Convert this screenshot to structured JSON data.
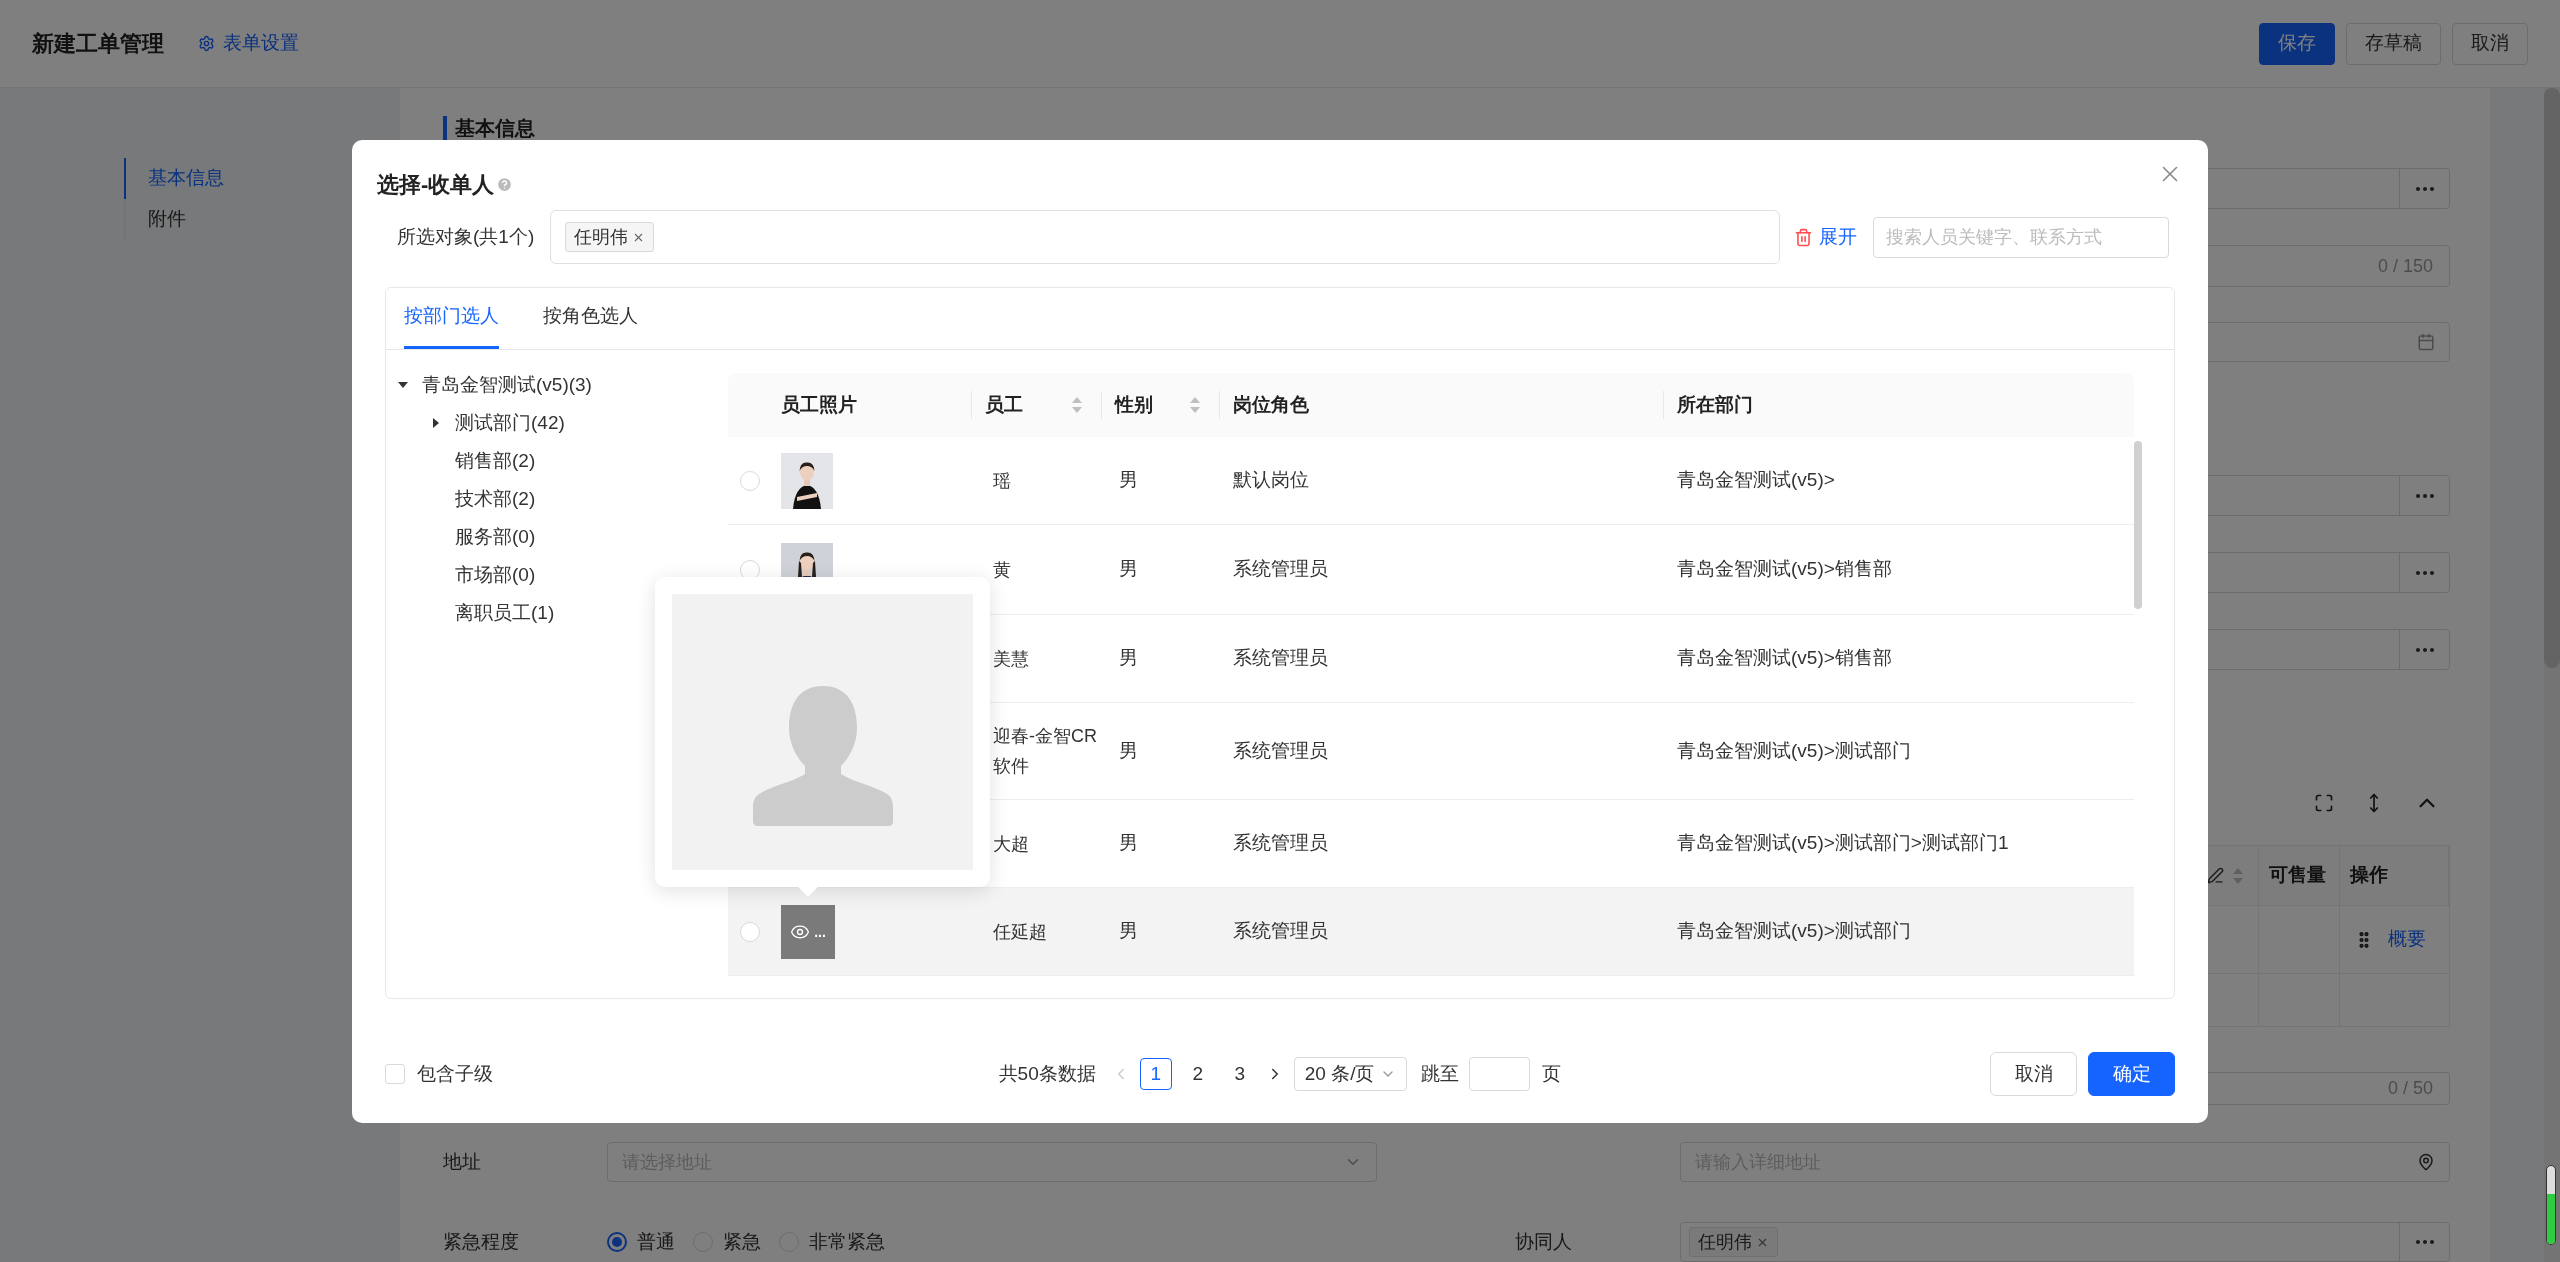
{
  "page": {
    "title": "新建工单管理",
    "settings_link": "表单设置",
    "buttons": [
      {
        "label": "保存",
        "kind": "primary"
      },
      {
        "label": "存草稿",
        "kind": "default"
      },
      {
        "label": "取消",
        "kind": "default"
      }
    ]
  },
  "nav": [
    {
      "label": "基本信息",
      "selected": true
    },
    {
      "label": "附件",
      "selected": false
    }
  ],
  "section_title": "基本信息",
  "form_top": [
    {
      "kind": "picker"
    },
    {
      "kind": "counter",
      "counter": "0 / 150"
    },
    {
      "kind": "date"
    },
    {
      "kind": "picker"
    },
    {
      "kind": "picker"
    },
    {
      "kind": "picker"
    }
  ],
  "detail_table": {
    "columns": [
      {
        "kind": "icons"
      },
      {
        "kind": "text",
        "label": "可售量"
      },
      {
        "kind": "text",
        "label": "操作"
      }
    ],
    "rows": [
      {
        "kind": "action",
        "action": "概要"
      },
      {
        "kind": "blank"
      }
    ]
  },
  "remark_counter": "0 / 50",
  "address": {
    "label": "地址",
    "region_placeholder": "请选择地址",
    "detail_placeholder": "请输入详细地址"
  },
  "urgency": {
    "label": "紧急程度",
    "options": [
      {
        "label": "普通",
        "selected": true
      },
      {
        "label": "紧急",
        "selected": false
      },
      {
        "label": "非常紧急",
        "selected": false
      }
    ]
  },
  "collaborator": {
    "label": "协同人",
    "tags": [
      "任明伟"
    ]
  },
  "modal": {
    "title": "选择-收单人",
    "selected_label": "所选对象(共1个)",
    "selected_tags": [
      "任明伟"
    ],
    "expand": "展开",
    "search_placeholder": "搜索人员关键字、联系方式",
    "tabs": [
      {
        "label": "按部门选人",
        "selected": true
      },
      {
        "label": "按角色选人",
        "selected": false
      }
    ],
    "tree": [
      {
        "label": "青岛金智测试(v5)(3)",
        "kind": "branch",
        "expanded": true,
        "children": [
          {
            "label": "测试部门(42)",
            "kind": "branch",
            "expanded": false
          },
          {
            "label": "销售部(2)",
            "kind": "leaf"
          },
          {
            "label": "技术部(2)",
            "kind": "leaf"
          },
          {
            "label": "服务部(0)",
            "kind": "leaf"
          },
          {
            "label": "市场部(0)",
            "kind": "leaf"
          },
          {
            "label": "离职员工(1)",
            "kind": "leaf"
          }
        ]
      }
    ],
    "table": {
      "columns": [
        {
          "label": "员工照片",
          "kind": "plain"
        },
        {
          "label": "员工",
          "kind": "sortable"
        },
        {
          "label": "性别",
          "kind": "sortable"
        },
        {
          "label": "岗位角色",
          "kind": "plain"
        },
        {
          "label": "所在部门",
          "kind": "plain"
        }
      ],
      "rows": [
        {
          "selected": false,
          "hovered": false,
          "name": "瑶",
          "gender": "男",
          "role": "默认岗位",
          "dept": "青岛金智测试(v5)>"
        },
        {
          "selected": false,
          "hovered": false,
          "name": "黄",
          "gender": "男",
          "role": "系统管理员",
          "dept": "青岛金智测试(v5)>销售部"
        },
        {
          "hovered": false,
          "name": "美慧",
          "gender": "男",
          "role": "系统管理员",
          "dept": "青岛金智测试(v5)>销售部"
        },
        {
          "hovered": false,
          "name": "迎春-金智CR\n软件",
          "gender": "男",
          "role": "系统管理员",
          "dept": "青岛金智测试(v5)>测试部门"
        },
        {
          "hovered": false,
          "name": "大超",
          "gender": "男",
          "role": "系统管理员",
          "dept": "青岛金智测试(v5)>测试部门>测试部门1"
        },
        {
          "selected": false,
          "hovered": true,
          "photo": {
            "kind": "preview",
            "label": "..."
          },
          "name": "任延超",
          "gender": "男",
          "role": "系统管理员",
          "dept": "青岛金智测试(v5)>测试部门"
        }
      ]
    },
    "photo_preview": {
      "kind": "placeholder"
    },
    "include_children": {
      "label": "包含子级",
      "checked": false
    },
    "pagination": {
      "total": "共50条数据",
      "pages": [
        {
          "label": "1",
          "selected": true
        },
        {
          "label": "2",
          "selected": false
        },
        {
          "label": "3",
          "selected": false
        }
      ],
      "page_size": "20 条/页",
      "jump_label": "跳至",
      "page_unit": "页"
    },
    "buttons": [
      {
        "label": "取消",
        "kind": "default"
      },
      {
        "label": "确定",
        "kind": "primary"
      }
    ]
  }
}
